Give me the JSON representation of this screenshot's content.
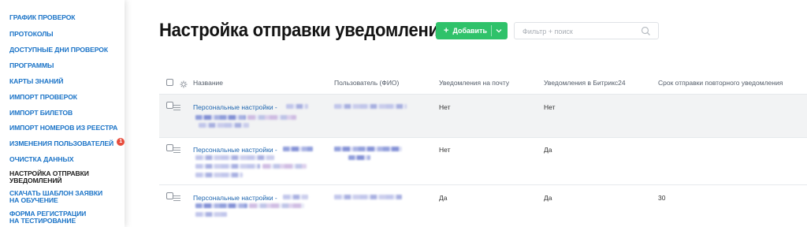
{
  "sidebar": {
    "items": [
      {
        "label": "ГРАФИК ПРОВЕРОК"
      },
      {
        "label": "ПРОТОКОЛЫ"
      },
      {
        "label": "ДОСТУПНЫЕ ДНИ ПРОВЕРОК"
      },
      {
        "label": "ПРОГРАММЫ"
      },
      {
        "label": "КАРТЫ ЗНАНИЙ"
      },
      {
        "label": "ИМПОРТ ПРОВЕРОК"
      },
      {
        "label": "ИМПОРТ БИЛЕТОВ"
      },
      {
        "label": "ИМПОРТ НОМЕРОВ ИЗ РЕЕСТРА"
      },
      {
        "label": "ИЗМЕНЕНИЯ ПОЛЬЗОВАТЕЛЕЙ",
        "badge": "1"
      },
      {
        "label": "ОЧИСТКА ДАННЫХ"
      },
      {
        "label": "НАСТРОЙКА ОТПРАВКИ УВЕДОМЛЕНИЙ"
      },
      {
        "label": "СКАЧАТЬ ШАБЛОН ЗАЯВКИ НА ОБУЧЕНИЕ"
      },
      {
        "label": "ФОРМА РЕГИСТРАЦИИ НА ТЕСТИРОВАНИЕ"
      }
    ]
  },
  "page": {
    "title": "Настройка отправки уведомлений"
  },
  "toolbar": {
    "add_label": "Добавить",
    "search_placeholder": "Фильтр + поиск"
  },
  "table": {
    "columns": [
      "Название",
      "Пользователь (ФИО)",
      "Уведомления на почту",
      "Уведомления в Битрикс24",
      "Срок отправки повторного уведомления"
    ],
    "rows": [
      {
        "name": "Персональные настройки -",
        "email": "Нет",
        "bitrix": "Нет",
        "term": ""
      },
      {
        "name": "Персональные настройки -",
        "email": "Нет",
        "bitrix": "Да",
        "term": ""
      },
      {
        "name": "Персональные настройки -",
        "email": "Да",
        "bitrix": "Да",
        "term": "30"
      }
    ]
  },
  "colors": {
    "accent": "#2fc26a",
    "link": "#2067b0",
    "nav": "#1a73c7",
    "badge": "#e74c3c"
  }
}
